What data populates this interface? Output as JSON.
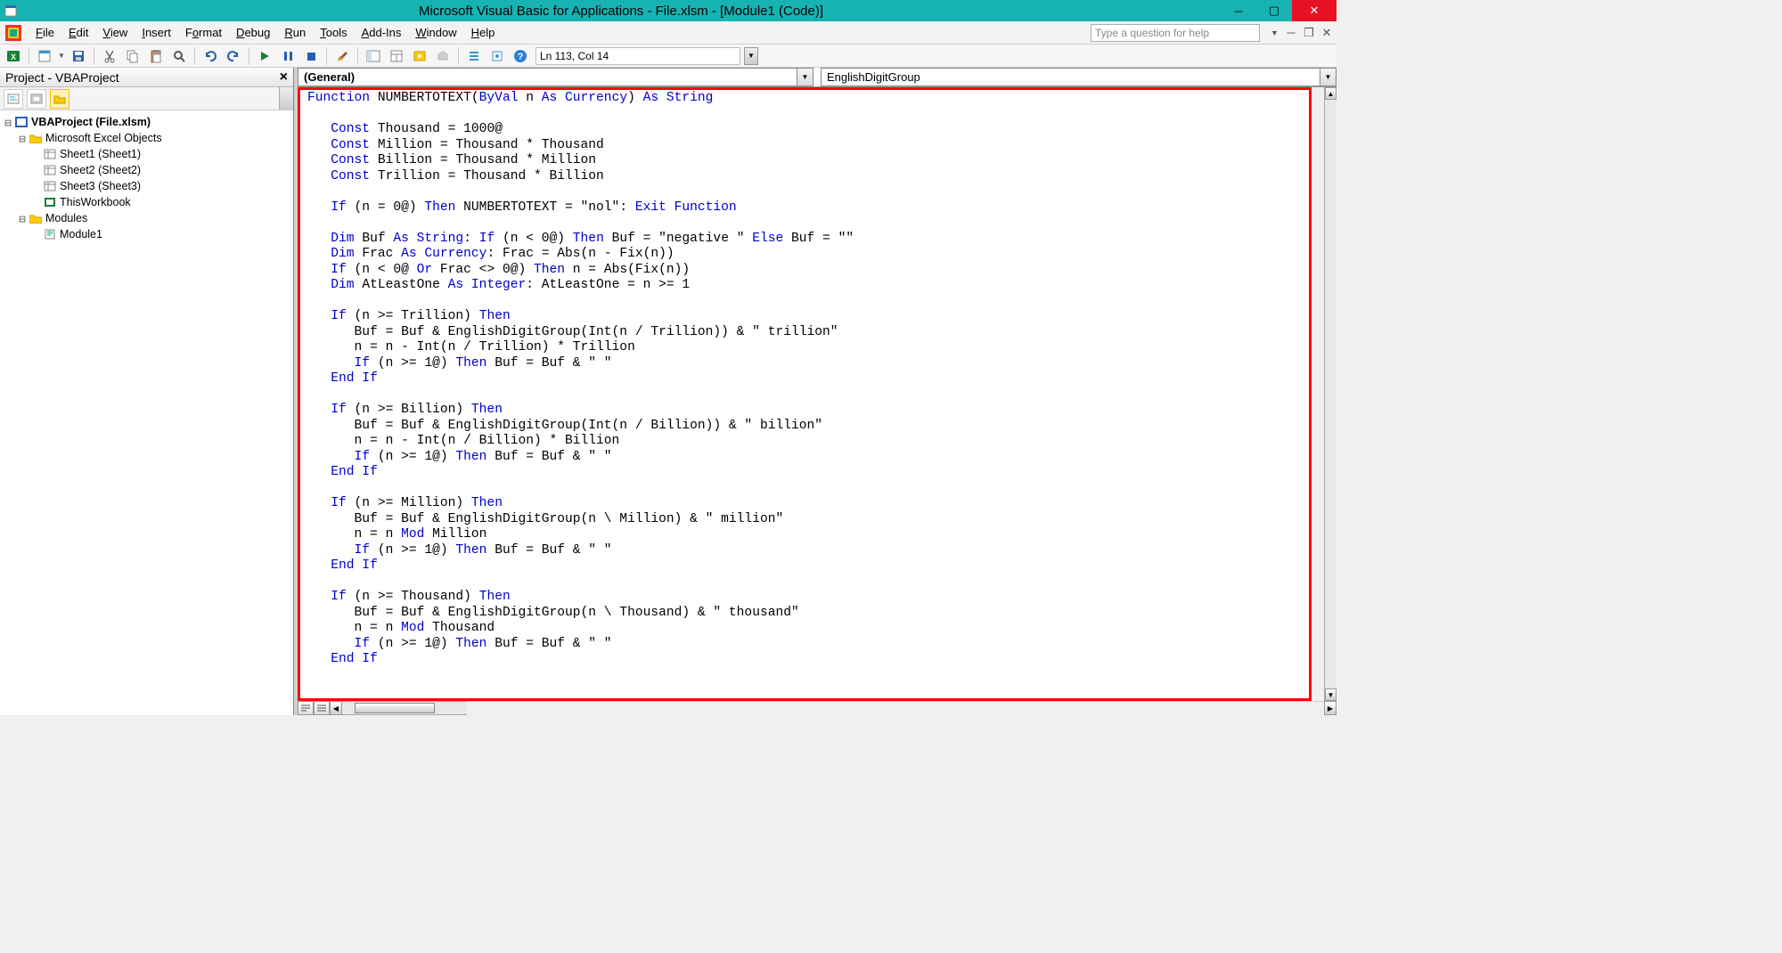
{
  "title": "Microsoft Visual Basic for Applications - File.xlsm - [Module1 (Code)]",
  "menus": {
    "file": {
      "key": "F",
      "rest": "ile"
    },
    "edit": {
      "key": "E",
      "rest": "dit"
    },
    "view": {
      "key": "V",
      "rest": "iew"
    },
    "insert": {
      "key": "I",
      "rest": "nsert"
    },
    "format": {
      "key": "o",
      "pre": "F",
      "rest": "rmat"
    },
    "debug": {
      "key": "D",
      "rest": "ebug"
    },
    "run": {
      "key": "R",
      "rest": "un"
    },
    "tools": {
      "key": "T",
      "rest": "ools"
    },
    "addins": {
      "key": "A",
      "rest": "dd-Ins"
    },
    "window": {
      "key": "W",
      "rest": "indow"
    },
    "help": {
      "key": "H",
      "rest": "elp"
    }
  },
  "help_placeholder": "Type a question for help",
  "status_pos": "Ln 113, Col 14",
  "project": {
    "title": "Project - VBAProject",
    "root": "VBAProject (File.xlsm)",
    "excel_objects": "Microsoft Excel Objects",
    "sheets": [
      "Sheet1 (Sheet1)",
      "Sheet2 (Sheet2)",
      "Sheet3 (Sheet3)"
    ],
    "thisworkbook": "ThisWorkbook",
    "modules_folder": "Modules",
    "module1": "Module1"
  },
  "code_dropdowns": {
    "left": "(General)",
    "right": "EnglishDigitGroup"
  },
  "code_lines": [
    {
      "i": 0,
      "t": [
        [
          "kw",
          "Function"
        ],
        [
          "",
          " NUMBERTOTEXT("
        ],
        [
          "kw",
          "ByVal"
        ],
        [
          "",
          " n "
        ],
        [
          "kw",
          "As Currency"
        ],
        [
          "",
          ") "
        ],
        [
          "kw",
          "As String"
        ]
      ]
    },
    {
      "i": 0,
      "t": [
        [
          "",
          ""
        ]
      ]
    },
    {
      "i": 1,
      "t": [
        [
          "kw",
          "Const"
        ],
        [
          "",
          " Thousand = 1000@"
        ]
      ]
    },
    {
      "i": 1,
      "t": [
        [
          "kw",
          "Const"
        ],
        [
          "",
          " Million = Thousand * Thousand"
        ]
      ]
    },
    {
      "i": 1,
      "t": [
        [
          "kw",
          "Const"
        ],
        [
          "",
          " Billion = Thousand * Million"
        ]
      ]
    },
    {
      "i": 1,
      "t": [
        [
          "kw",
          "Const"
        ],
        [
          "",
          " Trillion = Thousand * Billion"
        ]
      ]
    },
    {
      "i": 0,
      "t": [
        [
          "",
          ""
        ]
      ]
    },
    {
      "i": 1,
      "t": [
        [
          "kw",
          "If"
        ],
        [
          "",
          " (n = 0@) "
        ],
        [
          "kw",
          "Then"
        ],
        [
          "",
          " NUMBERTOTEXT = \"nol\": "
        ],
        [
          "kw",
          "Exit Function"
        ]
      ]
    },
    {
      "i": 0,
      "t": [
        [
          "",
          ""
        ]
      ]
    },
    {
      "i": 1,
      "t": [
        [
          "kw",
          "Dim"
        ],
        [
          "",
          " Buf "
        ],
        [
          "kw",
          "As String"
        ],
        [
          "",
          ": "
        ],
        [
          "kw",
          "If"
        ],
        [
          "",
          " (n < 0@) "
        ],
        [
          "kw",
          "Then"
        ],
        [
          "",
          " Buf = \"negative \" "
        ],
        [
          "kw",
          "Else"
        ],
        [
          "",
          " Buf = \"\""
        ]
      ]
    },
    {
      "i": 1,
      "t": [
        [
          "kw",
          "Dim"
        ],
        [
          "",
          " Frac "
        ],
        [
          "kw",
          "As Currency"
        ],
        [
          "",
          ": Frac = Abs(n - Fix(n))"
        ]
      ]
    },
    {
      "i": 1,
      "t": [
        [
          "kw",
          "If"
        ],
        [
          "",
          " (n < 0@ "
        ],
        [
          "kw",
          "Or"
        ],
        [
          "",
          " Frac <> 0@) "
        ],
        [
          "kw",
          "Then"
        ],
        [
          "",
          " n = Abs(Fix(n))"
        ]
      ]
    },
    {
      "i": 1,
      "t": [
        [
          "kw",
          "Dim"
        ],
        [
          "",
          " AtLeastOne "
        ],
        [
          "kw",
          "As Integer"
        ],
        [
          "",
          ": AtLeastOne = n >= 1"
        ]
      ]
    },
    {
      "i": 0,
      "t": [
        [
          "",
          ""
        ]
      ]
    },
    {
      "i": 1,
      "t": [
        [
          "kw",
          "If"
        ],
        [
          "",
          " (n >= Trillion) "
        ],
        [
          "kw",
          "Then"
        ]
      ]
    },
    {
      "i": 2,
      "t": [
        [
          "",
          "Buf = Buf & EnglishDigitGroup(Int(n / Trillion)) & \" trillion\""
        ]
      ]
    },
    {
      "i": 2,
      "t": [
        [
          "",
          "n = n - Int(n / Trillion) * Trillion"
        ]
      ]
    },
    {
      "i": 2,
      "t": [
        [
          "kw",
          "If"
        ],
        [
          "",
          " (n >= 1@) "
        ],
        [
          "kw",
          "Then"
        ],
        [
          "",
          " Buf = Buf & \" \""
        ]
      ]
    },
    {
      "i": 1,
      "t": [
        [
          "kw",
          "End If"
        ]
      ]
    },
    {
      "i": 0,
      "t": [
        [
          "",
          ""
        ]
      ]
    },
    {
      "i": 1,
      "t": [
        [
          "kw",
          "If"
        ],
        [
          "",
          " (n >= Billion) "
        ],
        [
          "kw",
          "Then"
        ]
      ]
    },
    {
      "i": 2,
      "t": [
        [
          "",
          "Buf = Buf & EnglishDigitGroup(Int(n / Billion)) & \" billion\""
        ]
      ]
    },
    {
      "i": 2,
      "t": [
        [
          "",
          "n = n - Int(n / Billion) * Billion"
        ]
      ]
    },
    {
      "i": 2,
      "t": [
        [
          "kw",
          "If"
        ],
        [
          "",
          " (n >= 1@) "
        ],
        [
          "kw",
          "Then"
        ],
        [
          "",
          " Buf = Buf & \" \""
        ]
      ]
    },
    {
      "i": 1,
      "t": [
        [
          "kw",
          "End If"
        ]
      ]
    },
    {
      "i": 0,
      "t": [
        [
          "",
          ""
        ]
      ]
    },
    {
      "i": 1,
      "t": [
        [
          "kw",
          "If"
        ],
        [
          "",
          " (n >= Million) "
        ],
        [
          "kw",
          "Then"
        ]
      ]
    },
    {
      "i": 2,
      "t": [
        [
          "",
          "Buf = Buf & EnglishDigitGroup(n \\ Million) & \" million\""
        ]
      ]
    },
    {
      "i": 2,
      "t": [
        [
          "",
          "n = n "
        ],
        [
          "kw",
          "Mod"
        ],
        [
          "",
          " Million"
        ]
      ]
    },
    {
      "i": 2,
      "t": [
        [
          "kw",
          "If"
        ],
        [
          "",
          " (n >= 1@) "
        ],
        [
          "kw",
          "Then"
        ],
        [
          "",
          " Buf = Buf & \" \""
        ]
      ]
    },
    {
      "i": 1,
      "t": [
        [
          "kw",
          "End If"
        ]
      ]
    },
    {
      "i": 0,
      "t": [
        [
          "",
          ""
        ]
      ]
    },
    {
      "i": 1,
      "t": [
        [
          "kw",
          "If"
        ],
        [
          "",
          " (n >= Thousand) "
        ],
        [
          "kw",
          "Then"
        ]
      ]
    },
    {
      "i": 2,
      "t": [
        [
          "",
          "Buf = Buf & EnglishDigitGroup(n \\ Thousand) & \" thousand\""
        ]
      ]
    },
    {
      "i": 2,
      "t": [
        [
          "",
          "n = n "
        ],
        [
          "kw",
          "Mod"
        ],
        [
          "",
          " Thousand"
        ]
      ]
    },
    {
      "i": 2,
      "t": [
        [
          "kw",
          "If"
        ],
        [
          "",
          " (n >= 1@) "
        ],
        [
          "kw",
          "Then"
        ],
        [
          "",
          " Buf = Buf & \" \""
        ]
      ]
    },
    {
      "i": 1,
      "t": [
        [
          "kw",
          "End If"
        ]
      ]
    },
    {
      "i": 0,
      "t": [
        [
          "",
          ""
        ]
      ]
    }
  ]
}
